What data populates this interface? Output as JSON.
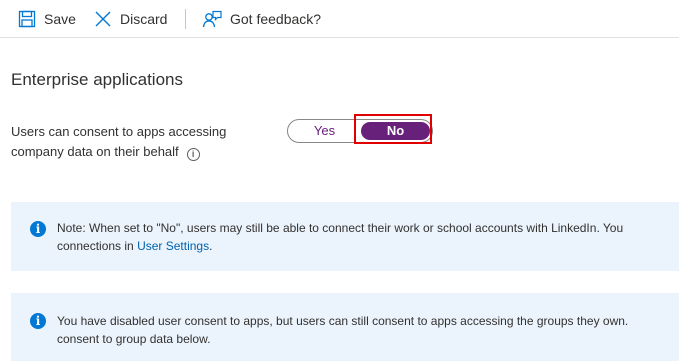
{
  "toolbar": {
    "save_label": "Save",
    "discard_label": "Discard",
    "feedback_label": "Got feedback?"
  },
  "section": {
    "title": "Enterprise applications"
  },
  "setting": {
    "label_line1": "Users can consent to apps accessing",
    "label_line2": "company data on their behalf",
    "info_glyph": "i",
    "toggle": {
      "yes_label": "Yes",
      "no_label": "No",
      "selected": "No"
    }
  },
  "banners": [
    {
      "icon": "info-icon",
      "line1": "Note: When set to \"No\", users may still be able to connect their work or school accounts with LinkedIn. You",
      "line2_prefix": "connections in ",
      "line2_link": "User Settings",
      "line2_suffix": "."
    },
    {
      "icon": "info-icon",
      "line1": "You have disabled user consent to apps, but users can still consent to apps accessing the groups they own.",
      "line2": "consent to group data below."
    }
  ],
  "colors": {
    "accent_purple": "#68217a",
    "info_blue": "#0078d4",
    "banner_bg": "#ebf3fc",
    "highlight_red": "#e00000"
  }
}
